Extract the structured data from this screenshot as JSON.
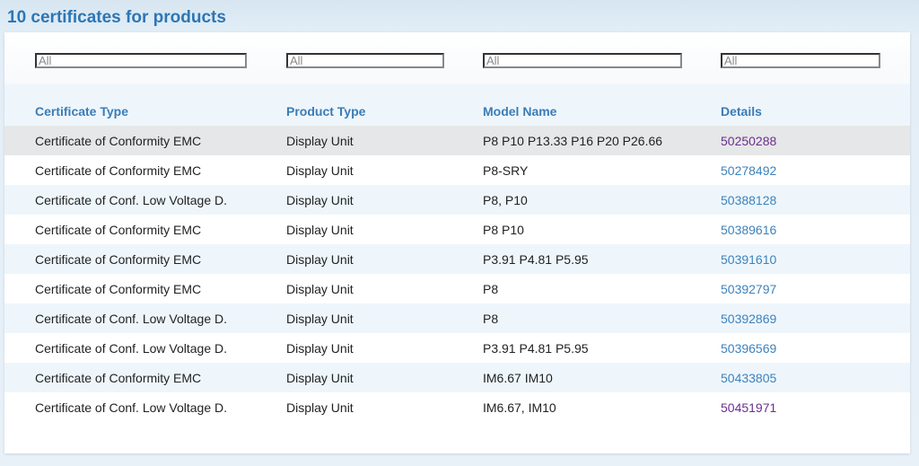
{
  "page": {
    "title": "10 certificates for products"
  },
  "filters": [
    {
      "placeholder": "All",
      "value": "All"
    },
    {
      "placeholder": "All",
      "value": "All"
    },
    {
      "placeholder": "All",
      "value": "All"
    },
    {
      "placeholder": "All",
      "value": "All"
    }
  ],
  "table": {
    "headers": [
      "Certificate Type",
      "Product Type",
      "Model Name",
      "Details"
    ],
    "rows": [
      {
        "certificate_type": "Certificate of Conformity EMC",
        "product_type": "Display Unit",
        "model_name": "P8 P10 P13.33 P16 P20 P26.66",
        "details": "50250288",
        "visited": true,
        "hovered": true
      },
      {
        "certificate_type": "Certificate of Conformity EMC",
        "product_type": "Display Unit",
        "model_name": "P8-SRY",
        "details": "50278492",
        "visited": false
      },
      {
        "certificate_type": "Certificate of Conf. Low Voltage D.",
        "product_type": "Display Unit",
        "model_name": "P8, P10",
        "details": "50388128",
        "visited": false
      },
      {
        "certificate_type": "Certificate of Conformity EMC",
        "product_type": "Display Unit",
        "model_name": "P8 P10",
        "details": "50389616",
        "visited": false
      },
      {
        "certificate_type": "Certificate of Conformity EMC",
        "product_type": "Display Unit",
        "model_name": "P3.91 P4.81 P5.95",
        "details": "50391610",
        "visited": false
      },
      {
        "certificate_type": "Certificate of Conformity EMC",
        "product_type": "Display Unit",
        "model_name": "P8",
        "details": "50392797",
        "visited": false
      },
      {
        "certificate_type": "Certificate of Conf. Low Voltage D.",
        "product_type": "Display Unit",
        "model_name": "P8",
        "details": "50392869",
        "visited": false
      },
      {
        "certificate_type": "Certificate of Conf. Low Voltage D.",
        "product_type": "Display Unit",
        "model_name": "P3.91 P4.81 P5.95",
        "details": "50396569",
        "visited": false
      },
      {
        "certificate_type": "Certificate of Conformity EMC",
        "product_type": "Display Unit",
        "model_name": "IM6.67 IM10",
        "details": "50433805",
        "visited": false
      },
      {
        "certificate_type": "Certificate of Conf. Low Voltage D.",
        "product_type": "Display Unit",
        "model_name": "IM6.67, IM10",
        "details": "50451971",
        "visited": true
      }
    ]
  },
  "colors": {
    "title": "#2d76b5",
    "header": "#3a7cb8",
    "link": "#3c82bc",
    "visited_link": "#6a2f8f"
  }
}
